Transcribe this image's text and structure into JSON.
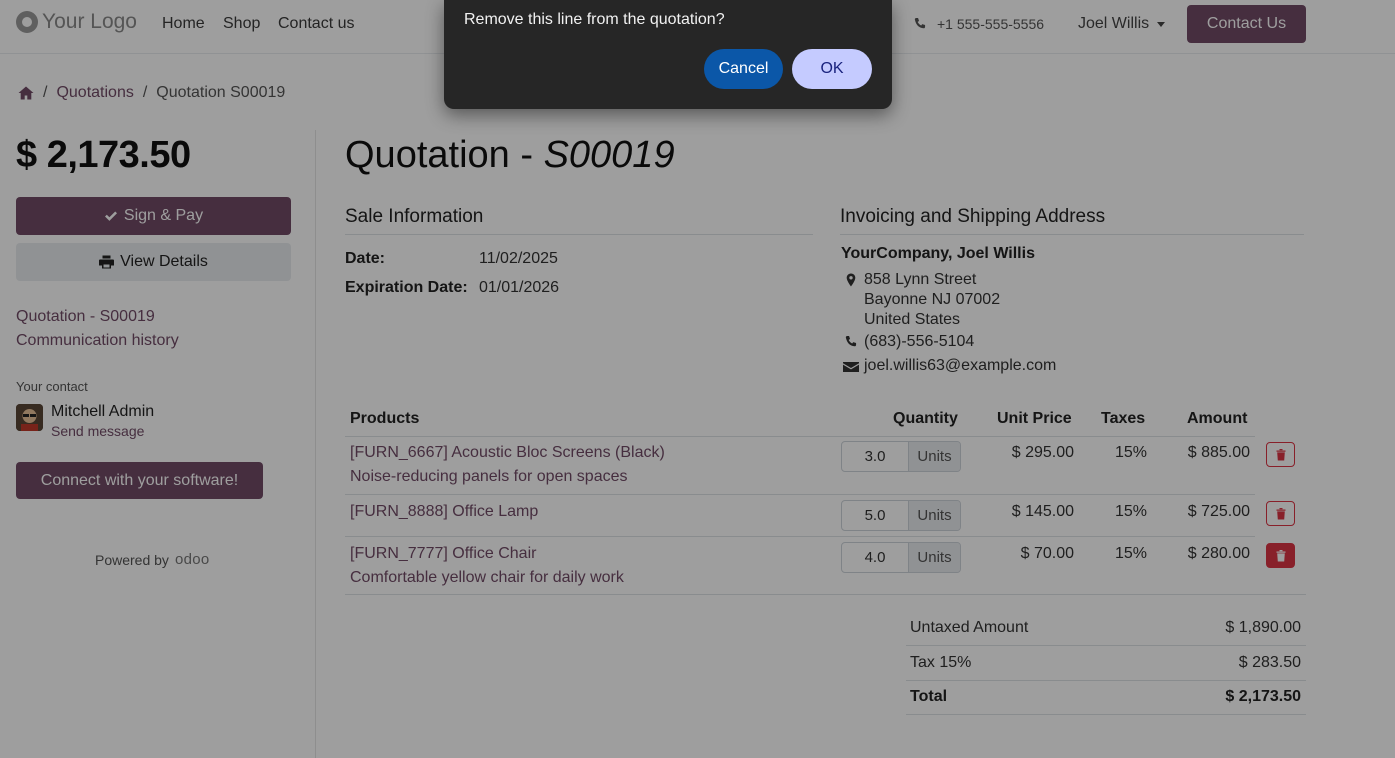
{
  "header": {
    "logo_text": "Your Logo",
    "nav": [
      "Home",
      "Shop",
      "Contact us"
    ],
    "phone": "+1 555-555-5556",
    "user": "Joel Willis",
    "contact_button": "Contact Us"
  },
  "breadcrumb": {
    "sep": "/",
    "items": [
      "Quotations",
      "Quotation S00019"
    ]
  },
  "sidebar": {
    "total": "$ 2,173.50",
    "sign_pay": "Sign & Pay",
    "view_details": "View Details",
    "links": [
      "Quotation - S00019",
      "Communication history"
    ],
    "contact_label": "Your contact",
    "contact_name": "Mitchell Admin",
    "send_message": "Send message",
    "connect_button": "Connect with your software!",
    "powered_by": "Powered by",
    "powered_brand": "odoo"
  },
  "quotation": {
    "title_prefix": "Quotation - ",
    "title_number": "S00019",
    "sale_info_title": "Sale Information",
    "date_label": "Date:",
    "date_value": "11/02/2025",
    "expiration_label": "Expiration Date:",
    "expiration_value": "01/01/2026",
    "address_title": "Invoicing and Shipping Address",
    "address_name": "YourCompany, Joel Willis",
    "address_lines": [
      "858 Lynn Street",
      "Bayonne NJ 07002",
      "United States"
    ],
    "phone": "(683)-556-5104",
    "email": "joel.willis63@example.com"
  },
  "table": {
    "headers": {
      "products": "Products",
      "quantity": "Quantity",
      "unit_price": "Unit Price",
      "taxes": "Taxes",
      "amount": "Amount"
    },
    "rows": [
      {
        "name": "[FURN_6667] Acoustic Bloc Screens (Black)",
        "desc": "Noise-reducing panels for open spaces",
        "qty": "3.0",
        "unit": "Units",
        "price": "$ 295.00",
        "tax": "15%",
        "amount": "$ 885.00"
      },
      {
        "name": "[FURN_8888] Office Lamp",
        "desc": "",
        "qty": "5.0",
        "unit": "Units",
        "price": "$ 145.00",
        "tax": "15%",
        "amount": "$ 725.00"
      },
      {
        "name": "[FURN_7777] Office Chair",
        "desc": "Comfortable yellow chair for daily work",
        "qty": "4.0",
        "unit": "Units",
        "price": "$ 70.00",
        "tax": "15%",
        "amount": "$ 280.00"
      }
    ]
  },
  "totals": {
    "untaxed_label": "Untaxed Amount",
    "untaxed_value": "$ 1,890.00",
    "tax_label": "Tax 15%",
    "tax_value": "$ 283.50",
    "total_label": "Total",
    "total_value": "$ 2,173.50"
  },
  "dialog": {
    "message": "Remove this line from the quotation?",
    "cancel": "Cancel",
    "ok": "OK"
  },
  "colors": {
    "brand": "#714B67",
    "danger": "#dc3545",
    "dialog_bg": "#262626",
    "cancel_bg": "#0b57a8",
    "ok_bg": "#c5cbff"
  },
  "icons": [
    "phone-icon",
    "caret-down-icon",
    "home-icon",
    "check-icon",
    "print-icon",
    "map-marker-icon",
    "envelope-icon",
    "trash-icon"
  ]
}
